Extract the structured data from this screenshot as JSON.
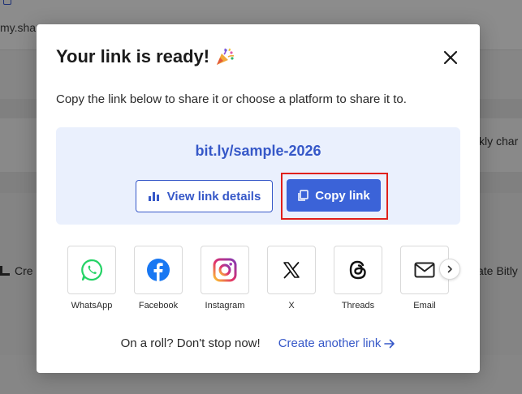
{
  "background": {
    "url_text": "my.share",
    "right_text": "kly char",
    "low_left_text": "Cre",
    "low_right_text": "ate Bitly"
  },
  "modal": {
    "title": "Your link is ready!",
    "subtitle": "Copy the link below to share it or choose a platform to share it to.",
    "short_link": "bit.ly/sample-2026",
    "view_details_label": "View link details",
    "copy_link_label": "Copy link",
    "platforms": [
      {
        "name": "WhatsApp",
        "icon": "whatsapp-icon",
        "color": "#25d366"
      },
      {
        "name": "Facebook",
        "icon": "facebook-icon",
        "color": "#1877f2"
      },
      {
        "name": "Instagram",
        "icon": "instagram-icon",
        "color": "#d62976"
      },
      {
        "name": "X",
        "icon": "x-icon",
        "color": "#111111"
      },
      {
        "name": "Threads",
        "icon": "threads-icon",
        "color": "#111111"
      },
      {
        "name": "Email",
        "icon": "email-icon",
        "color": "#222222"
      }
    ],
    "footer_text": "On a roll? Don't stop now!",
    "create_another_label": "Create another link"
  },
  "colors": {
    "accent": "#3b63d8",
    "link": "#3658c8",
    "highlight": "#e0201a",
    "linkbox_bg": "#eaf0fd"
  }
}
